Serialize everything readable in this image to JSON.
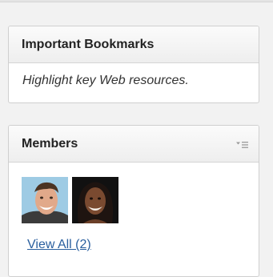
{
  "bookmarks_panel": {
    "title": "Important Bookmarks",
    "description": "Highlight key Web resources."
  },
  "members_panel": {
    "title": "Members",
    "menu_icon": "sort-menu-icon",
    "members": [
      {
        "avatar": "man-avatar"
      },
      {
        "avatar": "woman-avatar"
      }
    ],
    "view_all_label": "View All (2)"
  },
  "colors": {
    "link": "#2a5f9e",
    "panel_border": "#cfcfcf",
    "header_bg": "#f0f0f0",
    "page_bg": "#f2f2f2"
  }
}
